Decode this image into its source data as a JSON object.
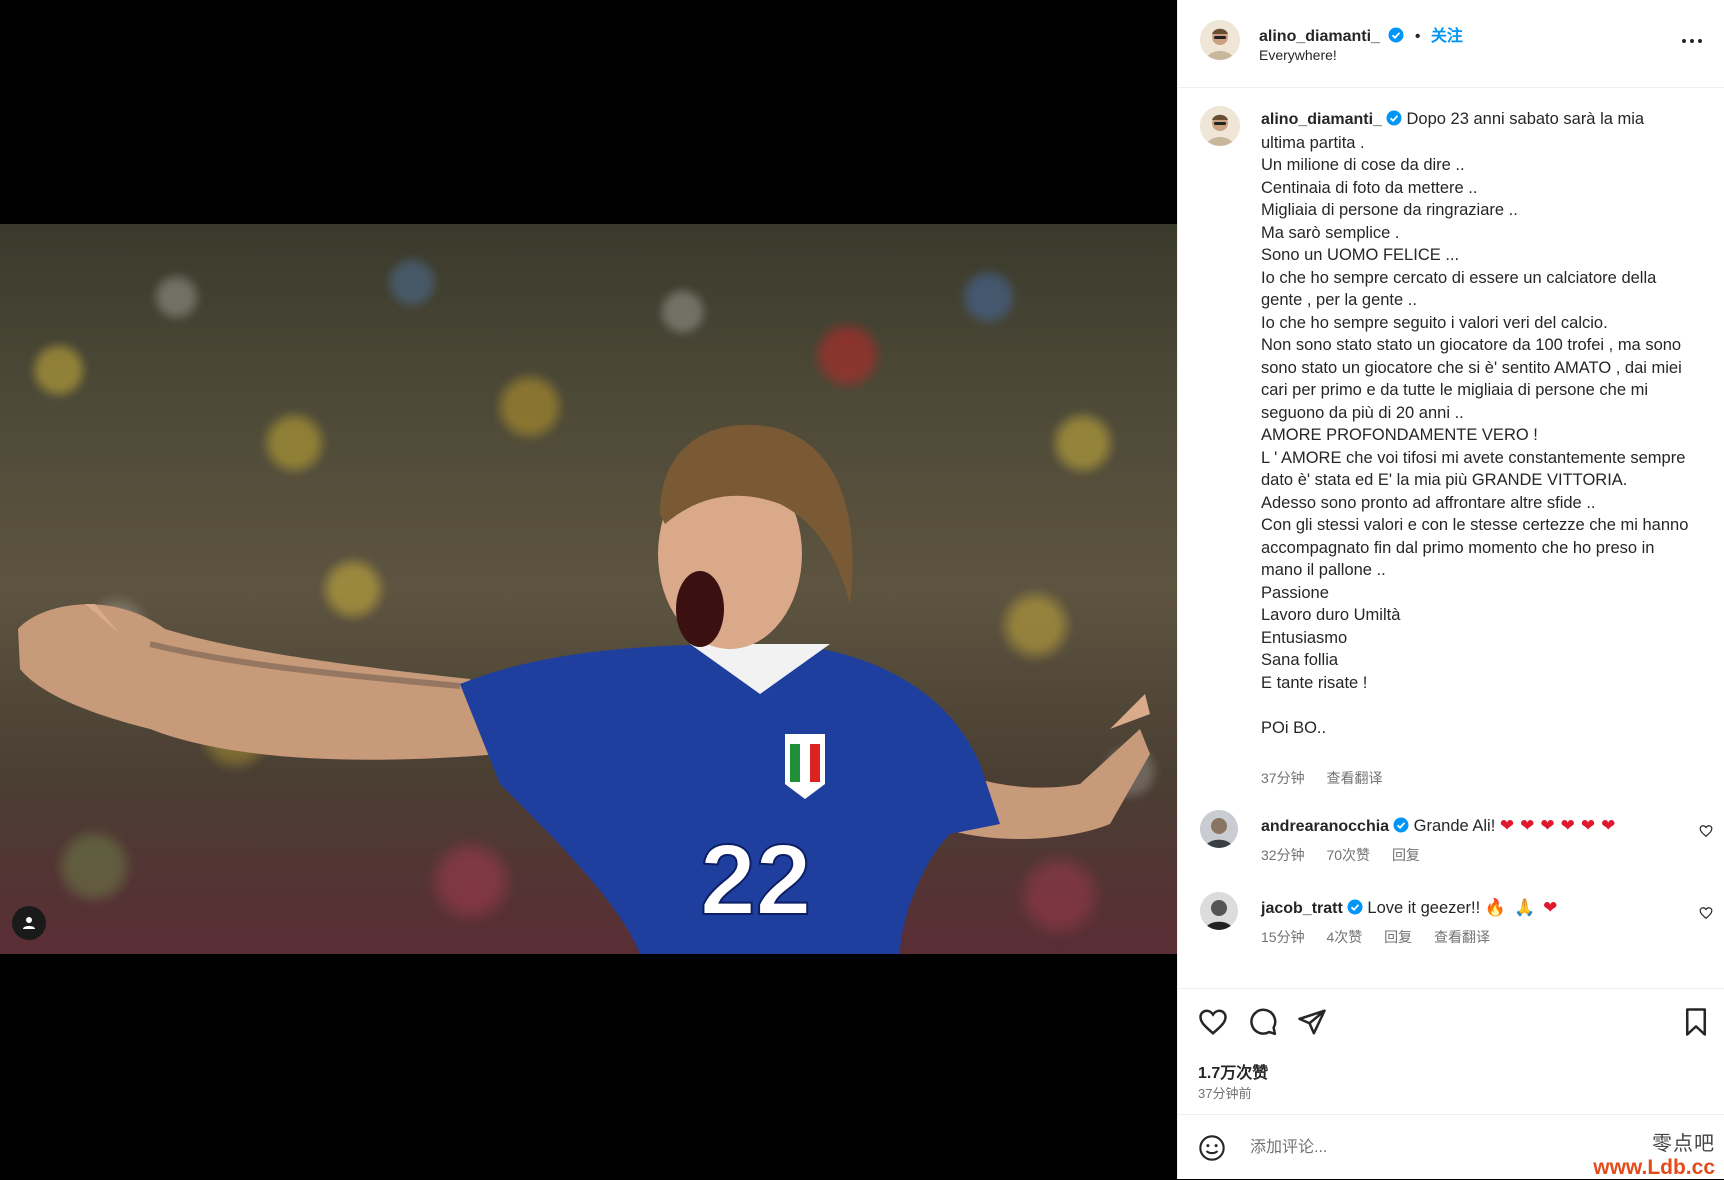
{
  "post": {
    "jersey_number": "22"
  },
  "header": {
    "username": "alino_diamanti_",
    "dot": "•",
    "follow_label": "关注",
    "subtitle": "Everywhere!",
    "more_icon": "more-horizontal-icon"
  },
  "caption": {
    "username": "alino_diamanti_",
    "text": "Dopo 23 anni sabato sarà la mia ultima partita .\nUn milione di cose da dire ..\nCentinaia di foto da mettere ..\nMigliaia di persone da ringraziare ..\nMa sarò semplice .\nSono un UOMO FELICE ...\nIo che ho sempre cercato di essere un calciatore della gente , per la gente ..\nIo che ho sempre seguito i valori veri del calcio.\nNon sono stato stato un giocatore da 100 trofei , ma sono sono stato un giocatore che si è' sentito AMATO , dai miei cari per primo e da tutte le migliaia di persone che mi seguono da più di 20 anni ..\nAMORE PROFONDAMENTE VERO !\nL ' AMORE che voi tifosi mi avete constantemente sempre dato è' stata ed E' la mia più GRANDE VITTORIA.\nAdesso sono pronto ad affrontare altre sfide ..\nCon gli stessi valori e con le stesse certezze che mi hanno accompagnato fin dal primo momento che ho preso in mano il pallone ..\nPassione\nLavoro duro Umiltà\nEntusiasmo\nSana follia\nE tante risate !\n\nPOi BO..",
    "time": "37分钟",
    "translate": "查看翻译"
  },
  "comments": [
    {
      "username": "andrearanocchia",
      "verified": true,
      "text": "Grande Ali!",
      "emoji": "❤❤❤❤❤❤",
      "time": "32分钟",
      "likes": "70次赞",
      "reply": "回复"
    },
    {
      "username": "jacob_tratt",
      "verified": true,
      "text": "Love it geezer!!",
      "emoji": "🔥🙏❤",
      "time": "15分钟",
      "likes": "4次赞",
      "reply": "回复",
      "translate": "查看翻译"
    }
  ],
  "actions": {
    "like_icon": "heart-icon",
    "comment_icon": "comment-icon",
    "share_icon": "send-icon",
    "save_icon": "bookmark-icon",
    "likes_count": "1.7万次赞",
    "posted": "37分钟前"
  },
  "comment_bar": {
    "placeholder": "添加评论...",
    "emoji_icon": "smiley-icon"
  },
  "watermark": {
    "top": "零点吧",
    "bottom": "www.Ldb.cc"
  }
}
